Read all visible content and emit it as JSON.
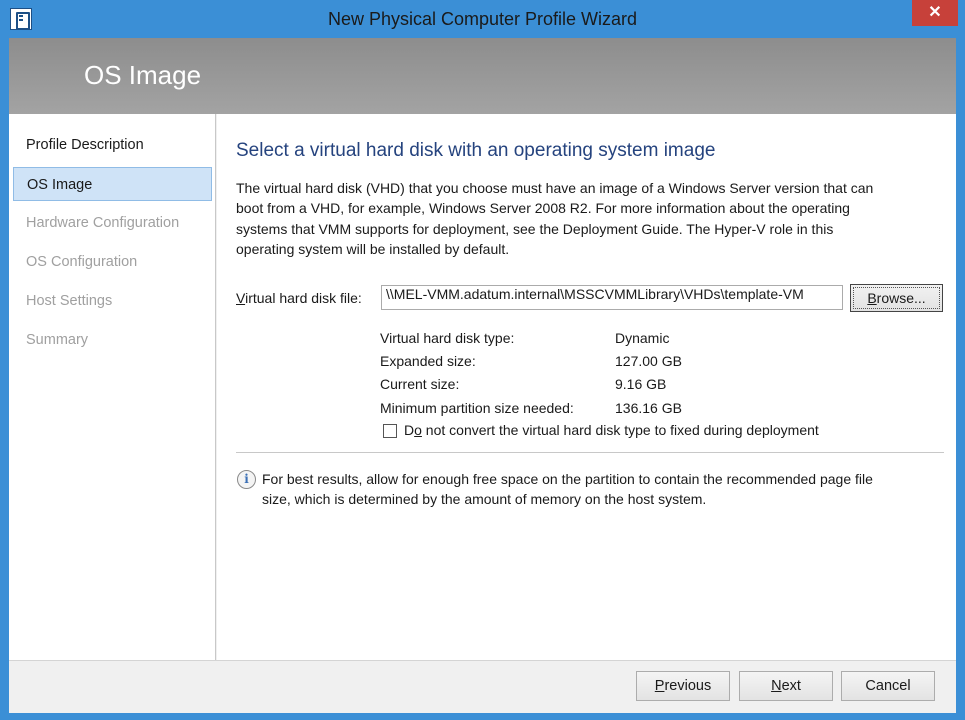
{
  "window": {
    "title": "New Physical Computer Profile Wizard",
    "close_glyph": "✕"
  },
  "header": {
    "title": "OS Image"
  },
  "sidebar": {
    "items": [
      {
        "label": "Profile Description",
        "state": "completed"
      },
      {
        "label": "OS Image",
        "state": "active"
      },
      {
        "label": "Hardware Configuration",
        "state": "pending"
      },
      {
        "label": "OS Configuration",
        "state": "pending"
      },
      {
        "label": "Host Settings",
        "state": "pending"
      },
      {
        "label": "Summary",
        "state": "pending"
      }
    ]
  },
  "main": {
    "heading": "Select a virtual hard disk with an operating system image",
    "description_lines": [
      "The virtual hard disk (VHD) that you choose must have an image of a Windows Server version that can",
      "boot from a VHD, for example, Windows Server 2008 R2. For more information about the operating",
      "systems that VMM supports for deployment, see the Deployment Guide. The Hyper-V role in this",
      "operating system will be installed by default."
    ],
    "vhd_file": {
      "label_accel": "V",
      "label_rest": "irtual hard disk file:",
      "value": "\\\\MEL-VMM.adatum.internal\\MSSCVMMLibrary\\VHDs\\template-VM",
      "browse_accel": "B",
      "browse_rest": "rowse..."
    },
    "properties": [
      {
        "label": "Virtual hard disk type:",
        "value": "Dynamic"
      },
      {
        "label": "Expanded size:",
        "value": "127.00 GB"
      },
      {
        "label": "Current size:",
        "value": "9.16 GB"
      },
      {
        "label": "Minimum partition size needed:",
        "value": "136.16 GB"
      }
    ],
    "no_convert": {
      "checked": false,
      "label_pre": "D",
      "label_accel": "o",
      "label_rest": " not convert the virtual hard disk type to fixed during deployment"
    },
    "info": {
      "icon": "info-icon",
      "lines": [
        "For best results, allow for enough free space on the partition to contain the recommended page file",
        "size, which is determined by the amount of memory on the host system."
      ]
    }
  },
  "footer": {
    "previous_accel": "P",
    "previous_rest": "revious",
    "next_accel": "N",
    "next_rest": "ext",
    "cancel": "Cancel"
  }
}
